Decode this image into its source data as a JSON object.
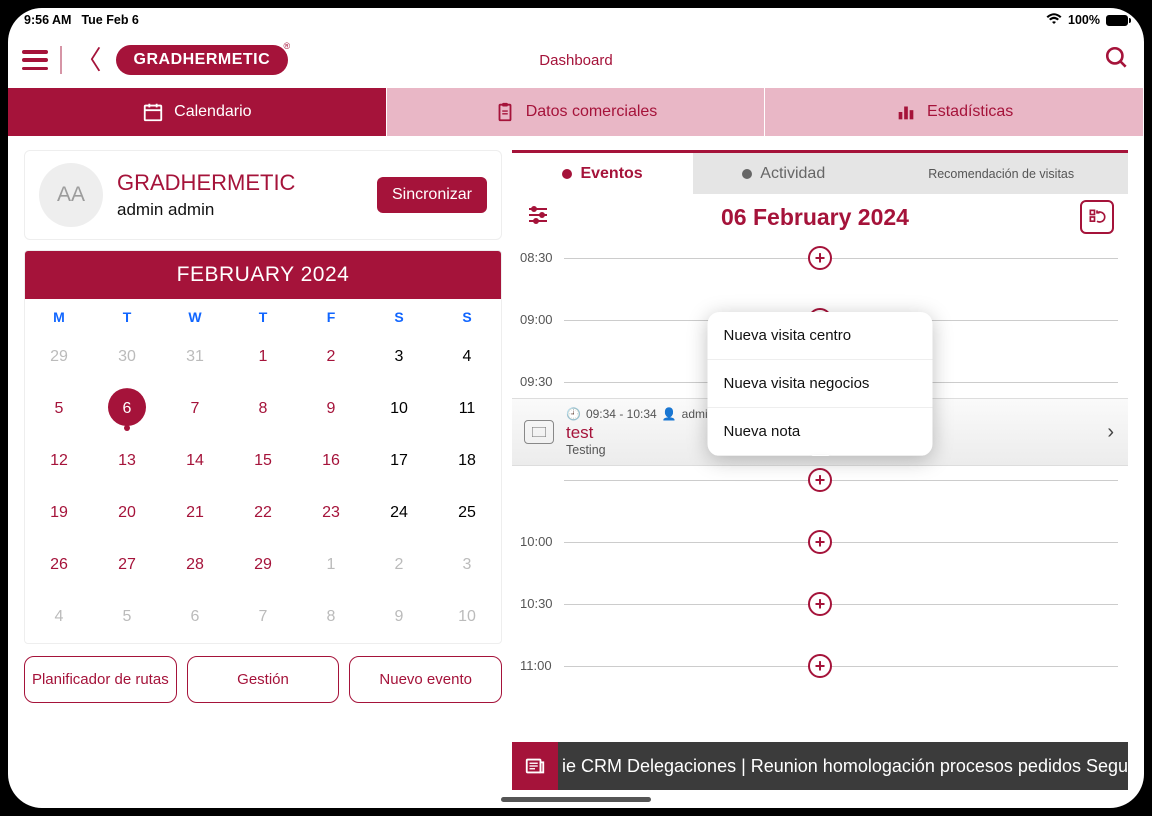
{
  "status": {
    "time": "9:56 AM",
    "date": "Tue Feb 6",
    "battery": "100%"
  },
  "brand": "GRADHERMETIC",
  "appbar_title": "Dashboard",
  "top_tabs": {
    "calendario": "Calendario",
    "datos": "Datos comerciales",
    "stats": "Estadísticas"
  },
  "profile": {
    "initials": "AA",
    "org": "GRADHERMETIC",
    "user": "admin admin",
    "sync": "Sincronizar"
  },
  "calendar": {
    "title": "FEBRUARY 2024",
    "dow": [
      "M",
      "T",
      "W",
      "T",
      "F",
      "S",
      "S"
    ],
    "weeks": [
      [
        {
          "n": "29",
          "d": 1
        },
        {
          "n": "30",
          "d": 1
        },
        {
          "n": "31",
          "d": 1
        },
        {
          "n": "1",
          "r": 1
        },
        {
          "n": "2",
          "r": 1
        },
        {
          "n": "3"
        },
        {
          "n": "4"
        }
      ],
      [
        {
          "n": "5",
          "r": 1
        },
        {
          "n": "6",
          "sel": 1,
          "dot": 1
        },
        {
          "n": "7",
          "r": 1
        },
        {
          "n": "8",
          "r": 1
        },
        {
          "n": "9",
          "r": 1
        },
        {
          "n": "10"
        },
        {
          "n": "11"
        }
      ],
      [
        {
          "n": "12",
          "r": 1
        },
        {
          "n": "13",
          "r": 1
        },
        {
          "n": "14",
          "r": 1
        },
        {
          "n": "15",
          "r": 1
        },
        {
          "n": "16",
          "r": 1
        },
        {
          "n": "17"
        },
        {
          "n": "18"
        }
      ],
      [
        {
          "n": "19",
          "r": 1
        },
        {
          "n": "20",
          "r": 1
        },
        {
          "n": "21",
          "r": 1
        },
        {
          "n": "22",
          "r": 1
        },
        {
          "n": "23",
          "r": 1
        },
        {
          "n": "24"
        },
        {
          "n": "25"
        }
      ],
      [
        {
          "n": "26",
          "r": 1
        },
        {
          "n": "27",
          "r": 1
        },
        {
          "n": "28",
          "r": 1
        },
        {
          "n": "29",
          "r": 1
        },
        {
          "n": "1",
          "d": 1
        },
        {
          "n": "2",
          "d": 1
        },
        {
          "n": "3",
          "d": 1
        }
      ],
      [
        {
          "n": "4",
          "d": 1
        },
        {
          "n": "5",
          "d": 1
        },
        {
          "n": "6",
          "d": 1
        },
        {
          "n": "7",
          "d": 1
        },
        {
          "n": "8",
          "d": 1
        },
        {
          "n": "9",
          "d": 1
        },
        {
          "n": "10",
          "d": 1
        }
      ]
    ]
  },
  "left_buttons": {
    "plan": "Planificador de rutas",
    "gestion": "Gestión",
    "nuevo": "Nuevo evento"
  },
  "inner_tabs": {
    "eventos": "Eventos",
    "actividad": "Actividad",
    "reco": "Recomendación de visitas"
  },
  "day_title": "06 February 2024",
  "time_slots": [
    "08:30",
    "09:00",
    "09:30",
    "",
    "10:00",
    "10:30",
    "11:00"
  ],
  "event": {
    "time": "09:34 - 10:34",
    "user": "admin",
    "title": "test",
    "sub": "Testing"
  },
  "popover": {
    "a": "Nueva visita centro",
    "b": "Nueva visita negocios",
    "c": "Nueva nota"
  },
  "ticker": "ie CRM Delegaciones | Reunion homologación procesos pedidos Seguimie"
}
